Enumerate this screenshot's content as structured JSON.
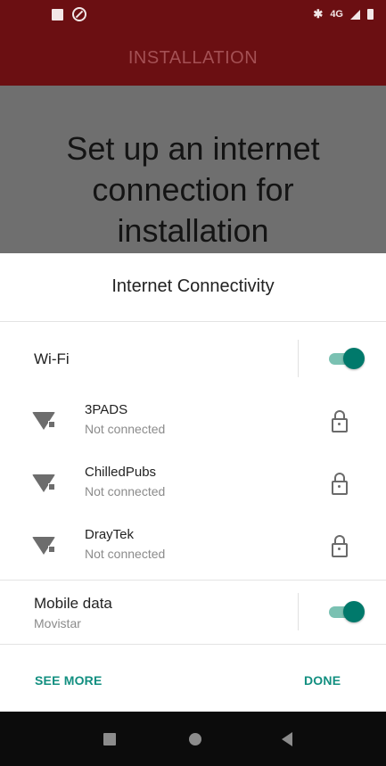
{
  "status_bar": {
    "icons_left": [
      "stop-square-icon",
      "dnd-icon"
    ],
    "right_text": "4G",
    "icons_right": [
      "bluetooth-icon",
      "signal-icon",
      "battery-icon"
    ]
  },
  "app_bar": {
    "title": "INSTALLATION"
  },
  "headline": {
    "text": "Set up an internet connection for installation"
  },
  "dialog": {
    "title": "Internet Connectivity",
    "wifi": {
      "label": "Wi-Fi",
      "enabled": true
    },
    "networks": [
      {
        "name": "3PADS",
        "status": "Not connected",
        "secured": true
      },
      {
        "name": "ChilledPubs",
        "status": "Not connected",
        "secured": true
      },
      {
        "name": "DrayTek",
        "status": "Not connected",
        "secured": true
      }
    ],
    "mobile_data": {
      "label": "Mobile data",
      "carrier": "Movistar",
      "enabled": true
    },
    "actions": {
      "see_more": "SEE MORE",
      "done": "DONE"
    }
  },
  "colors": {
    "app_bar": "#6b0f12",
    "accent": "#00796b",
    "action_text": "#128f80",
    "scrim": "#6f6f6f"
  }
}
